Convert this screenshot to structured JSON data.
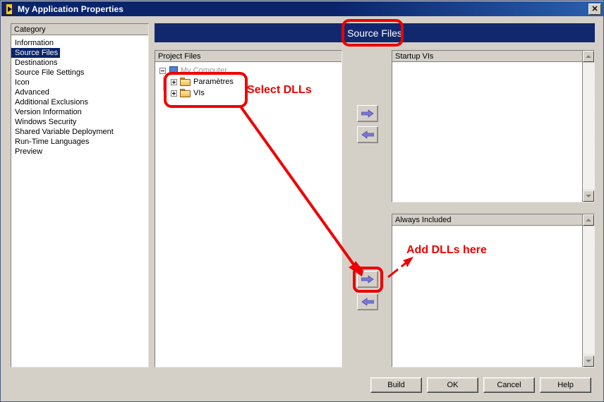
{
  "window": {
    "title": "My Application Properties",
    "icon": "labview-icon",
    "close_label": "✕"
  },
  "category_panel": {
    "header": "Category",
    "selected": "Source Files",
    "items": [
      {
        "label": "Information"
      },
      {
        "label": "Source Files"
      },
      {
        "label": "Destinations"
      },
      {
        "label": "Source File Settings"
      },
      {
        "label": "Icon"
      },
      {
        "label": "Advanced"
      },
      {
        "label": "Additional Exclusions"
      },
      {
        "label": "Version Information"
      },
      {
        "label": "Windows Security"
      },
      {
        "label": "Shared Variable Deployment"
      },
      {
        "label": "Run-Time Languages"
      },
      {
        "label": "Preview"
      }
    ]
  },
  "banner": {
    "title": "Source Files"
  },
  "project_files": {
    "header": "Project Files",
    "tree": [
      {
        "label": "My Computer",
        "icon": "computer-icon",
        "expander": "minus",
        "dim": true
      },
      {
        "label": "Paramètres",
        "icon": "folder-icon",
        "expander": "plus",
        "dim": false
      },
      {
        "label": "VIs",
        "icon": "folder-icon",
        "expander": "plus",
        "dim": false
      }
    ]
  },
  "startup_vis": {
    "header": "Startup VIs",
    "items": []
  },
  "always_included": {
    "header": "Always Included",
    "items": []
  },
  "transfer_buttons": {
    "add_startup": "right-arrow-icon",
    "remove_startup": "left-arrow-icon",
    "add_included": "right-arrow-icon",
    "remove_included": "left-arrow-icon"
  },
  "dialog_buttons": {
    "build": "Build",
    "ok": "OK",
    "cancel": "Cancel",
    "help": "Help"
  },
  "annotations": {
    "select_dlls": "Select DLLs",
    "add_dlls": "Add DLLs here",
    "color": "#ee0000"
  },
  "colors": {
    "window_background": "#d4d0c8",
    "titlebar": "#0a246a",
    "banner": "#12286e",
    "selection": "#0a246a",
    "arrow_glyph": "#7b79d6",
    "annotation_red": "#ee0000",
    "panel_white": "#ffffff"
  }
}
